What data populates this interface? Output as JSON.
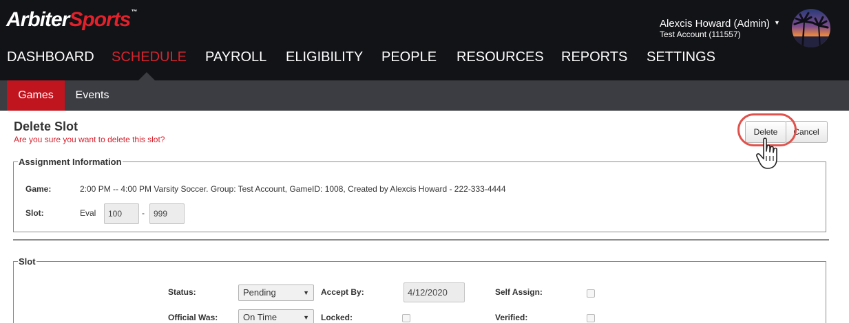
{
  "brand": {
    "logo_part1": "Arbiter",
    "logo_part2": "Sports",
    "logo_mark": "™"
  },
  "user": {
    "name": "Alexcis Howard (Admin)",
    "account": "Test Account (111557)"
  },
  "nav": {
    "items": [
      "DASHBOARD",
      "SCHEDULE",
      "PAYROLL",
      "ELIGIBILITY",
      "PEOPLE",
      "RESOURCES",
      "REPORTS",
      "SETTINGS"
    ],
    "active": "SCHEDULE"
  },
  "subnav": {
    "items": [
      "Games",
      "Events"
    ],
    "active": "Games"
  },
  "page": {
    "title": "Delete Slot",
    "subtitle": "Are you sure you want to delete this slot?",
    "delete_label": "Delete",
    "cancel_label": "Cancel"
  },
  "assignment": {
    "legend": "Assignment Information",
    "game_label": "Game:",
    "game_value": "2:00 PM -- 4:00 PM Varsity Soccer. Group: Test Account, GameID: 1008, Created by Alexcis Howard - 222-333-4444",
    "slot_label": "Slot:",
    "slot_type": "Eval",
    "slot_from": "100",
    "slot_sep": "-",
    "slot_to": "999"
  },
  "slot": {
    "legend": "Slot",
    "status_label": "Status:",
    "status_value": "Pending",
    "accept_by_label": "Accept By:",
    "accept_by_value": "4/12/2020",
    "self_assign_label": "Self Assign:",
    "official_was_label": "Official Was:",
    "official_was_value": "On Time",
    "locked_label": "Locked:",
    "verified_label": "Verified:"
  },
  "colors": {
    "accent_red": "#d6232f",
    "header_bg": "#121317",
    "subnav_bg": "#3c3d42",
    "highlight_ring": "#e0524c"
  },
  "icons": {
    "dropdown": "caret-down-icon",
    "pointer": "hand-pointer-icon"
  }
}
